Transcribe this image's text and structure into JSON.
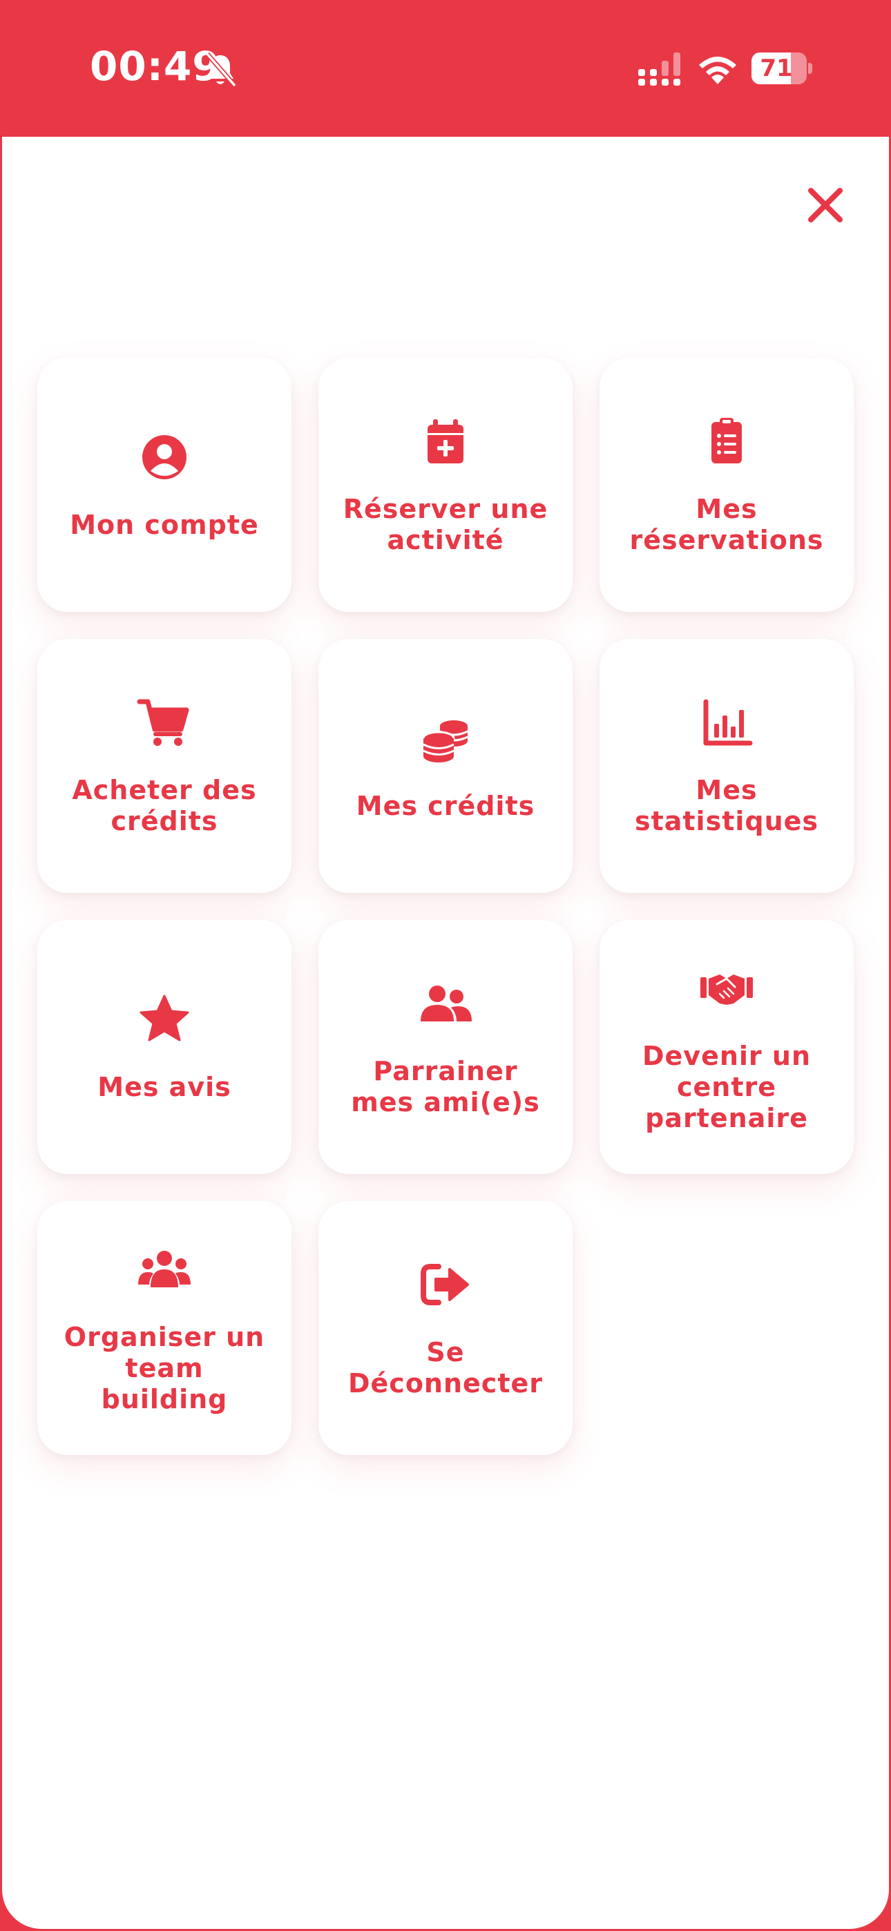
{
  "status_bar": {
    "time": "00:49",
    "battery_level": "71",
    "battery_fraction": 0.71
  },
  "theme": {
    "accent": "#e83846",
    "tile_background": "#ffffff"
  },
  "menu": {
    "close_icon": "close-icon",
    "items": [
      {
        "label": "Mon compte",
        "icon": "user-circle-icon"
      },
      {
        "label": "Réserver une activité",
        "icon": "calendar-plus-icon"
      },
      {
        "label": "Mes réservations",
        "icon": "clipboard-list-icon"
      },
      {
        "label": "Acheter des crédits",
        "icon": "cart-icon"
      },
      {
        "label": "Mes crédits",
        "icon": "coins-icon"
      },
      {
        "label": "Mes statistiques",
        "icon": "bar-chart-icon"
      },
      {
        "label": "Mes avis",
        "icon": "star-icon"
      },
      {
        "label": "Parrainer mes ami(e)s",
        "icon": "user-friends-icon"
      },
      {
        "label": "Devenir un centre partenaire",
        "icon": "handshake-icon"
      },
      {
        "label": "Organiser un team building",
        "icon": "users-group-icon"
      },
      {
        "label": "Se Déconnecter",
        "icon": "sign-out-icon"
      }
    ]
  }
}
